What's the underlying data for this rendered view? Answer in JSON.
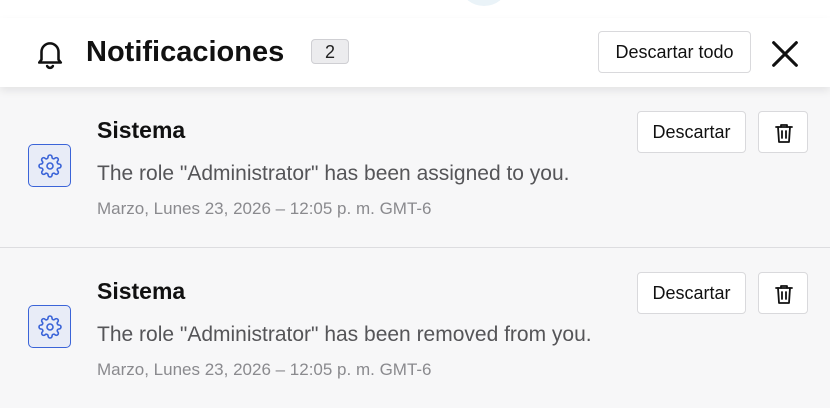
{
  "header": {
    "title": "Notificaciones",
    "count": "2",
    "dismiss_all_label": "Descartar todo",
    "bell_icon": "bell-icon",
    "close_icon": "close-icon"
  },
  "notifications": [
    {
      "source": "Sistema",
      "message": "The role \"Administrator\" has been assigned to you.",
      "timestamp": "Marzo, Lunes 23, 2026 – 12:05 p. m. GMT-6",
      "dismiss_label": "Descartar",
      "icon": "gear-icon"
    },
    {
      "source": "Sistema",
      "message": "The role \"Administrator\" has been removed from you.",
      "timestamp": "Marzo, Lunes 23, 2026 – 12:05 p. m. GMT-6",
      "dismiss_label": "Descartar",
      "icon": "gear-icon"
    }
  ],
  "colors": {
    "accent": "#3b64d8",
    "background": "#f7f7f8",
    "header_bg": "#ffffff"
  }
}
